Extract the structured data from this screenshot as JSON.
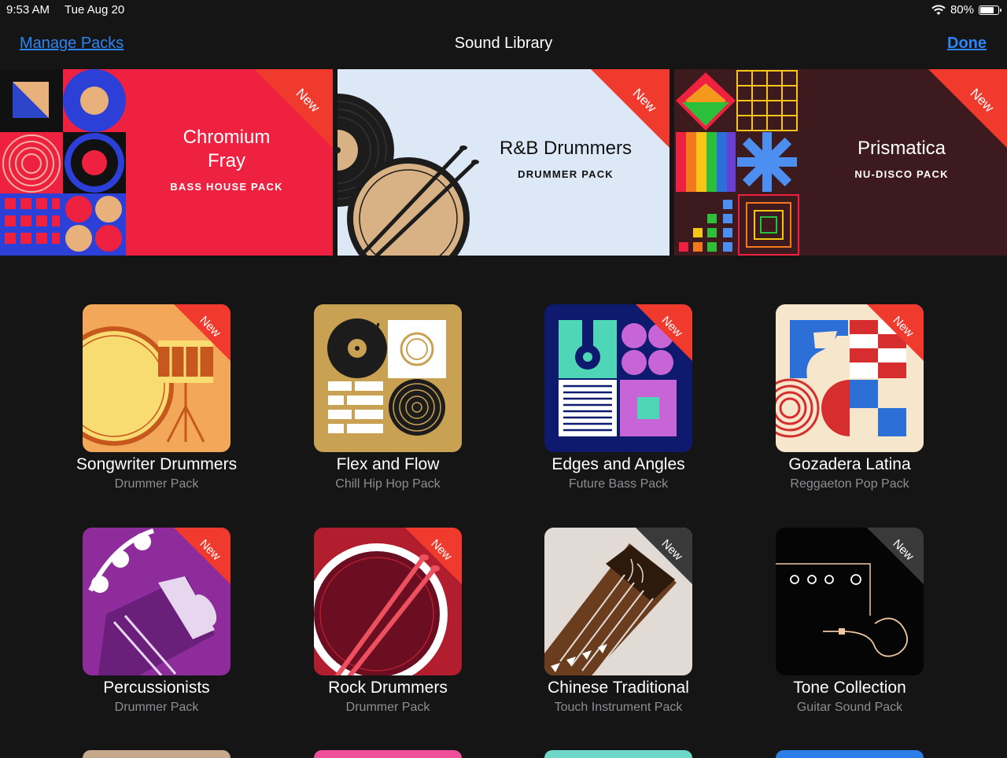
{
  "status": {
    "time": "9:53 AM",
    "date": "Tue Aug 20",
    "battery": "80%",
    "battery_level": 0.8
  },
  "nav": {
    "left": "Manage Packs",
    "title": "Sound Library",
    "right": "Done"
  },
  "banners": [
    {
      "title_line1": "Chromium",
      "title_line2": "Fray",
      "subtitle": "BASS HOUSE PACK",
      "badge": "New"
    },
    {
      "title": "R&B Drummers",
      "subtitle": "DRUMMER PACK",
      "badge": "New"
    },
    {
      "title": "Prismatica",
      "subtitle": "NU-DISCO PACK",
      "badge": "New"
    }
  ],
  "packs": [
    {
      "name": "Songwriter Drummers",
      "subtitle": "Drummer Pack",
      "badge": "New"
    },
    {
      "name": "Flex and Flow",
      "subtitle": "Chill Hip Hop Pack"
    },
    {
      "name": "Edges and Angles",
      "subtitle": "Future Bass Pack",
      "badge": "New"
    },
    {
      "name": "Gozadera Latina",
      "subtitle": "Reggaeton Pop Pack",
      "badge": "New"
    },
    {
      "name": "Percussionists",
      "subtitle": "Drummer Pack",
      "badge": "New"
    },
    {
      "name": "Rock Drummers",
      "subtitle": "Drummer Pack",
      "badge": "New"
    },
    {
      "name": "Chinese Traditional",
      "subtitle": "Touch Instrument Pack",
      "badge": "New"
    },
    {
      "name": "Tone Collection",
      "subtitle": "Guitar Sound Pack",
      "badge": "New"
    }
  ],
  "colors": {
    "accent": "#2f84f5",
    "badge": "#ef3a2d",
    "badge_dark": "#3a3a3a",
    "background": "#151516",
    "muted": "#8e8e93"
  }
}
